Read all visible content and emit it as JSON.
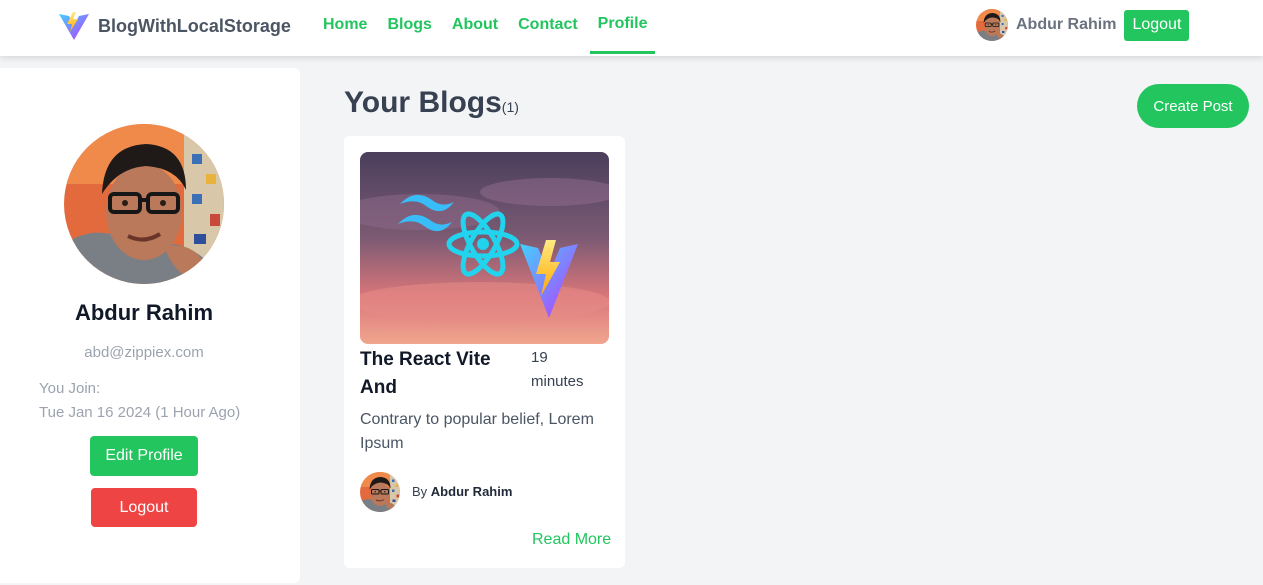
{
  "navbar": {
    "brand_name": "BlogWithLocalStorage",
    "links": [
      {
        "label": "Home"
      },
      {
        "label": "Blogs"
      },
      {
        "label": "About"
      },
      {
        "label": "Contact"
      },
      {
        "label": "Profile",
        "active": true
      }
    ],
    "user_name": "Abdur Rahim",
    "logout_label": "Logout"
  },
  "profile": {
    "name": "Abdur Rahim",
    "email": "abd@zippiex.com",
    "join_label": "You Join:",
    "join_date": "Tue Jan 16 2024 (1 Hour Ago)",
    "edit_label": "Edit Profile",
    "logout_label": "Logout"
  },
  "main": {
    "title": "Your Blogs",
    "count": "(1)",
    "create_label": "Create Post"
  },
  "blogs": [
    {
      "title": "The React Vite And",
      "read_time": "19 minutes",
      "excerpt": "Contrary to popular belief, Lorem Ipsum",
      "author_prefix": "By",
      "author_name": "Abdur Rahim",
      "read_more": "Read More"
    }
  ],
  "colors": {
    "accent": "#22c55e",
    "danger": "#ef4444",
    "background": "#f3f4f6"
  },
  "icons": {
    "brand": "vite-logo-icon",
    "card_image": [
      "tailwind-logo-icon",
      "react-logo-icon",
      "vite-logo-icon"
    ]
  }
}
